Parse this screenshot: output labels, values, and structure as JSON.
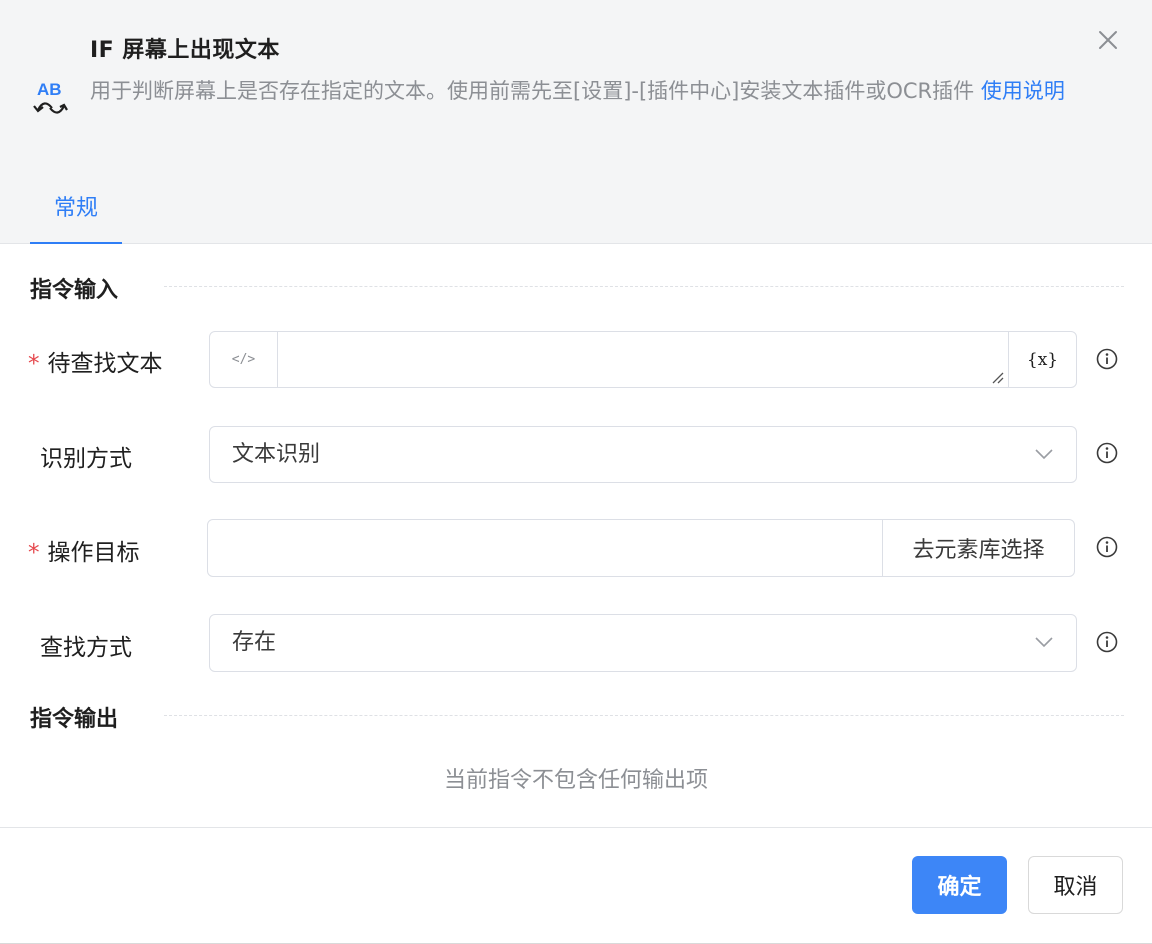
{
  "dialog": {
    "title": "IF 屏幕上出现文本",
    "description": "用于判断屏幕上是否存在指定的文本。使用前需先至[设置]-[插件中心]安装文本插件或OCR插件",
    "help_link": "使用说明",
    "icon": "ab-swap-icon",
    "close_icon": "close-icon"
  },
  "tabs": [
    {
      "label": "常规",
      "active": true
    }
  ],
  "input_section": {
    "title": "指令输入",
    "fields": [
      {
        "label": "待查找文本",
        "required": true,
        "value": "",
        "code_toggle": "</>",
        "variable_button": "{x}"
      },
      {
        "label": "识别方式",
        "required": false,
        "value": "文本识别"
      },
      {
        "label": "操作目标",
        "required": true,
        "value": "",
        "side_button": "去元素库选择"
      },
      {
        "label": "查找方式",
        "required": false,
        "value": "存在"
      }
    ]
  },
  "output_section": {
    "title": "指令输出",
    "empty_text": "当前指令不包含任何输出项"
  },
  "footer": {
    "confirm": "确定",
    "cancel": "取消"
  },
  "colors": {
    "accent": "#2f7ef6",
    "primary_button": "#3d86f7",
    "required_star": "#e5484d",
    "header_bg": "#f4f5f6"
  }
}
